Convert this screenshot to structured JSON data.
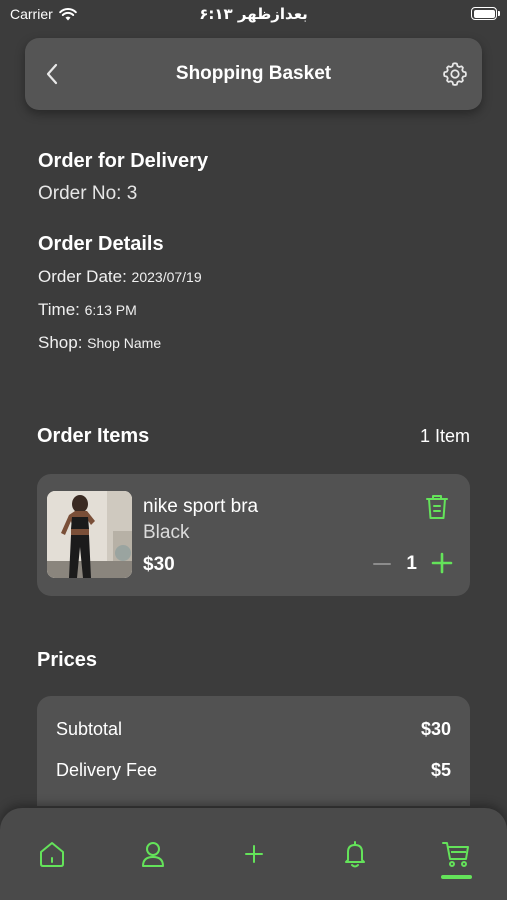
{
  "status_bar": {
    "carrier": "Carrier",
    "time": "۶:۱۳ بعدازظهر"
  },
  "header": {
    "title": "Shopping Basket",
    "back_icon": "chevron-left-icon",
    "settings_icon": "gear-icon"
  },
  "order": {
    "delivery_title": "Order for Delivery",
    "order_no_label": "Order No: 3"
  },
  "details": {
    "title": "Order Details",
    "date_label": "Order Date:",
    "date_value": "2023/07/19",
    "time_label": "Time:",
    "time_value": "6:13 PM",
    "shop_label": "Shop:",
    "shop_value": "Shop Name"
  },
  "items": {
    "title": "Order Items",
    "count": "1 Item",
    "list": [
      {
        "name": "nike sport bra",
        "color": "Black",
        "price": "$30",
        "quantity": "1"
      }
    ]
  },
  "prices": {
    "title": "Prices",
    "rows": [
      {
        "label": "Subtotal",
        "amount": "$30"
      },
      {
        "label": "Delivery Fee",
        "amount": "$5"
      }
    ]
  },
  "tabs": [
    {
      "icon": "home-icon"
    },
    {
      "icon": "user-icon"
    },
    {
      "icon": "plus-icon"
    },
    {
      "icon": "bell-icon"
    },
    {
      "icon": "cart-icon",
      "active": true
    }
  ],
  "colors": {
    "accent": "#64e35a",
    "background": "#3c3c3c",
    "card": "#525252"
  }
}
